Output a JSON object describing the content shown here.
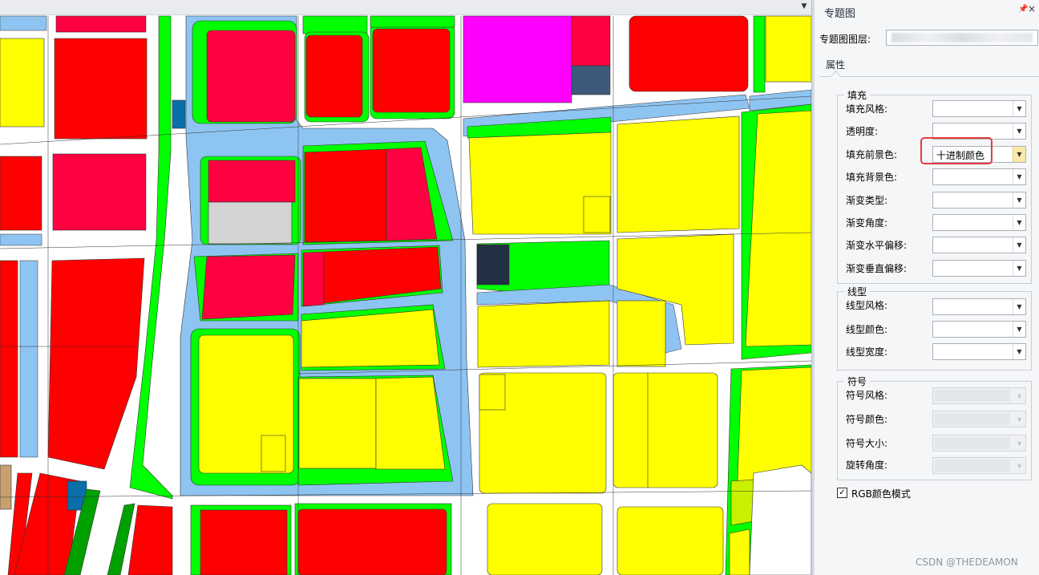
{
  "panel": {
    "title": "专题图",
    "layer_label": "专题图图层:",
    "tab_label": "属性"
  },
  "groups": {
    "fill": {
      "title": "填充",
      "rows": [
        {
          "label": "填充风格:",
          "value": ""
        },
        {
          "label": "透明度:",
          "value": ""
        },
        {
          "label": "填充前景色:",
          "value": "十进制颜色"
        },
        {
          "label": "填充背景色:",
          "value": ""
        },
        {
          "label": "渐变类型:",
          "value": ""
        },
        {
          "label": "渐变角度:",
          "value": ""
        },
        {
          "label": "渐变水平偏移:",
          "value": ""
        },
        {
          "label": "渐变垂直偏移:",
          "value": ""
        }
      ]
    },
    "line": {
      "title": "线型",
      "rows": [
        {
          "label": "线型风格:",
          "value": ""
        },
        {
          "label": "线型颜色:",
          "value": ""
        },
        {
          "label": "线型宽度:",
          "value": ""
        }
      ]
    },
    "symbol": {
      "title": "符号",
      "rows": [
        {
          "label": "符号风格:",
          "value": ""
        },
        {
          "label": "符号颜色:",
          "value": ""
        },
        {
          "label": "符号大小:",
          "value": ""
        },
        {
          "label": "旋转角度:",
          "value": ""
        }
      ]
    }
  },
  "rgb_mode": {
    "label": "RGB颜色模式",
    "checked": true
  },
  "watermark": "CSDN @THEDEAMON",
  "colors": {
    "residential": "#ffff00",
    "commercial": "#ff0000",
    "commercial_alt": "#ff0040",
    "green": "#00ff00",
    "dark_green": "#00a000",
    "water": "#8ec4f2",
    "road": "#ffffff",
    "magenta": "#ff00ff",
    "slate": "#3d5a7a",
    "navy": "#223044",
    "gray": "#d3d3d3",
    "teal": "#0a6ea8",
    "tan": "#c8a070",
    "lime": "#c8f000",
    "highlight": "#e53c3c"
  }
}
